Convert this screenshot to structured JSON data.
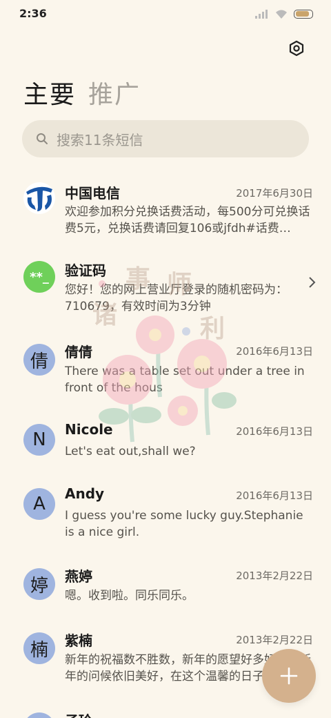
{
  "status": {
    "time": "2:36",
    "battery_level": 0.85,
    "accent": "#c9a46b"
  },
  "header": {
    "tabs": [
      {
        "label": "主要",
        "active": true
      },
      {
        "label": "推广",
        "active": false
      }
    ],
    "settings_icon": "gear-hexagon-icon"
  },
  "search": {
    "placeholder": "搜索11条短信",
    "icon": "search-icon"
  },
  "messages": [
    {
      "name": "中国电信",
      "date": "2017年6月30日",
      "preview": "欢迎参加积分兑换话费活动，每500分可兑换话费5元，兑换话费请回复106或jfdh#话费…",
      "avatar": "telecom-logo",
      "avatar_color": "#1a56a6"
    },
    {
      "name": "验证码",
      "date": "",
      "preview": "您好！您的网上营业厅登录的随机密码为：710679，有效时间为3分钟",
      "avatar_text": "**_",
      "avatar_color": "#6fd05a"
    },
    {
      "name": "倩倩",
      "date": "2016年6月13日",
      "preview": "There was a table set out under a tree in front of the hous",
      "avatar_text": "倩"
    },
    {
      "name": "Nicole",
      "date": "2016年6月13日",
      "preview": "Let's eat out,shall we?",
      "avatar_text": "N"
    },
    {
      "name": "Andy",
      "date": "2016年6月13日",
      "preview": "I guess you're some lucky guy.Stephanie is a nice girl.",
      "avatar_text": "A"
    },
    {
      "name": "燕婷",
      "date": "2013年2月22日",
      "preview": "嗯。收到啦。同乐同乐。",
      "avatar_text": "婷"
    },
    {
      "name": "紫楠",
      "date": "2013年2月22日",
      "preview": "新年的祝福数不胜数，新年的愿望好多好多，新年的问候依旧美好，在这个温馨的日子里",
      "avatar_text": "楠"
    },
    {
      "name": "子玲",
      "date": "",
      "preview": "",
      "avatar_text": ""
    }
  ],
  "watermark": {
    "text": [
      "事",
      "师",
      "诸",
      "利"
    ]
  },
  "fab": {
    "icon": "plus-icon"
  }
}
